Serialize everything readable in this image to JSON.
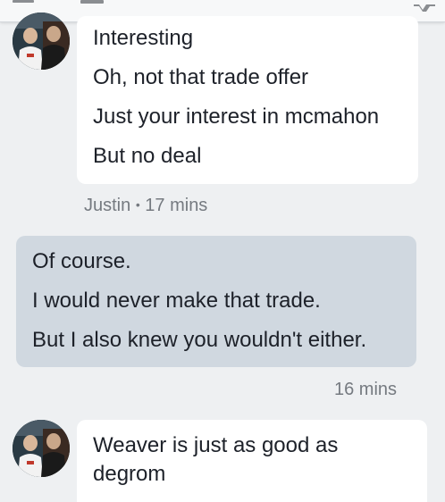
{
  "conversation": {
    "groups": [
      {
        "sender": "Justin",
        "direction": "incoming",
        "time": "17 mins",
        "messages": [
          "Interesting",
          "Oh, not that trade offer",
          "Just your interest in mcmahon",
          "But no deal"
        ]
      },
      {
        "direction": "outgoing",
        "time": "16 mins",
        "messages": [
          "Of course.",
          "I would never make that trade.",
          "But I also knew you wouldn't either."
        ]
      },
      {
        "direction": "incoming",
        "messages": [
          "Weaver is just as good as",
          "degrom"
        ]
      }
    ],
    "meta_separator": "•"
  },
  "colors": {
    "background": "#eef0f2",
    "incoming_bubble": "#ffffff",
    "outgoing_bubble": "#d0d8e0",
    "meta_text": "#757a80"
  },
  "icons": {
    "top_left": "menu-icon",
    "top_middle": "inbox-icon",
    "top_right": "notifications-icon"
  }
}
